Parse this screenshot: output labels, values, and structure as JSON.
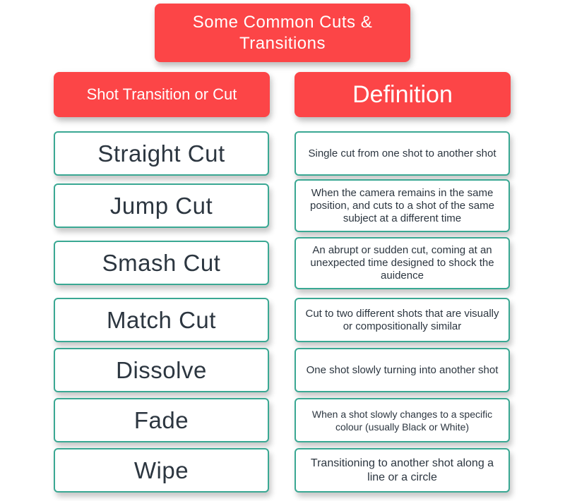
{
  "title": "Some Common Cuts & Transitions",
  "headers": {
    "left": "Shot Transition or Cut",
    "right": "Definition"
  },
  "colors": {
    "header_red": "#fc4547",
    "border_teal": "#3aa893",
    "text_dark": "#2c3640"
  },
  "rows": [
    {
      "term": "Straight Cut",
      "definition": "Single cut from one shot to another shot"
    },
    {
      "term": "Jump Cut",
      "definition": "When the camera remains in the same position, and cuts to a shot of the same subject at a different time"
    },
    {
      "term": "Smash Cut",
      "definition": "An abrupt or sudden cut, coming at an unexpected time designed to shock the auidence"
    },
    {
      "term": "Match Cut",
      "definition": "Cut to two different shots that are visually or compositionally similar"
    },
    {
      "term": "Dissolve",
      "definition": "One shot slowly turning into another shot"
    },
    {
      "term": "Fade",
      "definition": "When a shot slowly changes to a specific colour (usually Black or White)"
    },
    {
      "term": "Wipe",
      "definition": "Transitioning to another shot along a line or a circle"
    }
  ]
}
